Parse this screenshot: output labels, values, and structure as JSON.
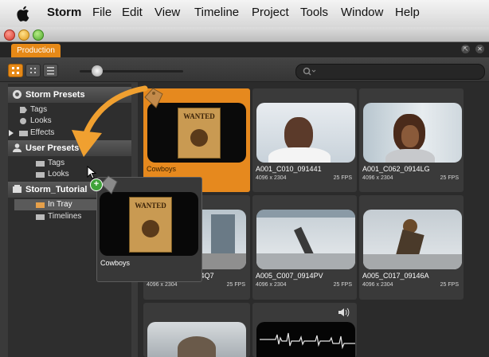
{
  "menubar": {
    "app_name": "Storm",
    "items": [
      "File",
      "Edit",
      "View",
      "Timeline",
      "Project",
      "Tools",
      "Window",
      "Help"
    ]
  },
  "tab": {
    "label": "Production"
  },
  "sidebar": {
    "storm_presets": {
      "title": "Storm Presets",
      "items": [
        "Tags",
        "Looks",
        "Effects"
      ]
    },
    "user_presets": {
      "title": "User Presets",
      "items": [
        "Tags",
        "Looks"
      ]
    },
    "storm_tutorial": {
      "title": "Storm_Tutorial",
      "items": [
        "In Tray",
        "Timelines"
      ]
    }
  },
  "clips": [
    {
      "name": "Cowboys",
      "size": "",
      "fps": ""
    },
    {
      "name": "A001_C010_091441",
      "size": "4096 x 2304",
      "fps": "25 FPS"
    },
    {
      "name": "A001_C062_0914LG",
      "size": "4096 x 2304",
      "fps": "25 FPS"
    },
    {
      "name": "A001_C079_0914Q7",
      "size": "4096 x 2304",
      "fps": "25 FPS"
    },
    {
      "name": "A005_C007_0914PV",
      "size": "4096 x 2304",
      "fps": "25 FPS"
    },
    {
      "name": "A005_C017_09146A",
      "size": "4096 x 2304",
      "fps": "25 FPS"
    }
  ],
  "drag": {
    "name": "Cowboys",
    "poster_text": "WANTED"
  },
  "poster": {
    "text": "WANTED"
  },
  "colors": {
    "accent": "#e68917",
    "background": "#2b2b2b"
  }
}
